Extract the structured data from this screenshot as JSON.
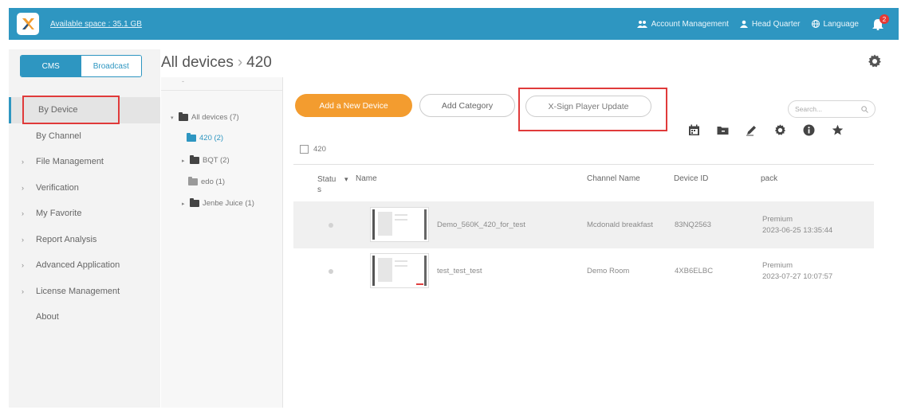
{
  "topbar": {
    "space": "Available space : 35.1 GB",
    "account": "Account Management",
    "hq": "Head Quarter",
    "language": "Language",
    "badge": "2",
    "bg_color": "#2e96c1"
  },
  "tabs": {
    "cms": "CMS",
    "broadcast": "Broadcast"
  },
  "nav": [
    {
      "label": "By Device"
    },
    {
      "label": "By Channel"
    },
    {
      "label": "File Management"
    },
    {
      "label": "Verification"
    },
    {
      "label": "My Favorite"
    },
    {
      "label": "Report Analysis"
    },
    {
      "label": "Advanced Application"
    },
    {
      "label": "License Management"
    },
    {
      "label": "About"
    }
  ],
  "page": {
    "root": "All devices",
    "sep": "›",
    "current": "420"
  },
  "tree": {
    "top": "-",
    "items": [
      {
        "label": "All devices (7)"
      },
      {
        "label": "420 (2)"
      },
      {
        "label": "BQT (2)"
      },
      {
        "label": "edo (1)"
      },
      {
        "label": "Jenbe Juice (1)"
      }
    ]
  },
  "actions": {
    "add_device": "Add a New Device",
    "add_category": "Add Category",
    "player_update": "X-Sign Player Update",
    "search_placeholder": "Search..."
  },
  "list_header": {
    "group": "420"
  },
  "table": {
    "headers": {
      "status": "Statu s",
      "name": "Name",
      "channel": "Channel Name",
      "device_id": "Device ID",
      "pack": "pack"
    },
    "rows": [
      {
        "name": "Demo_560K_420_for_test",
        "channel": "Mcdonald breakfast",
        "device_id": "83NQ2563",
        "pack": "Premium",
        "date": "2023-06-25 13:35:44"
      },
      {
        "name": "test_test_test",
        "channel": "Demo Room",
        "device_id": "4XB6ELBC",
        "pack": "Premium",
        "date": "2023-07-27 10:07:57"
      }
    ]
  },
  "colors": {
    "accent": "#2e96c1",
    "orange": "#f39c2f",
    "highlight_red": "#e03a3a"
  },
  "icons": [
    "logo-x-icon",
    "account-icon",
    "user-icon",
    "globe-icon",
    "bell-icon",
    "gear-icon",
    "calendar-icon",
    "folder-icon",
    "pencil-icon",
    "settings-icon",
    "info-icon",
    "star-icon",
    "search-icon"
  ]
}
